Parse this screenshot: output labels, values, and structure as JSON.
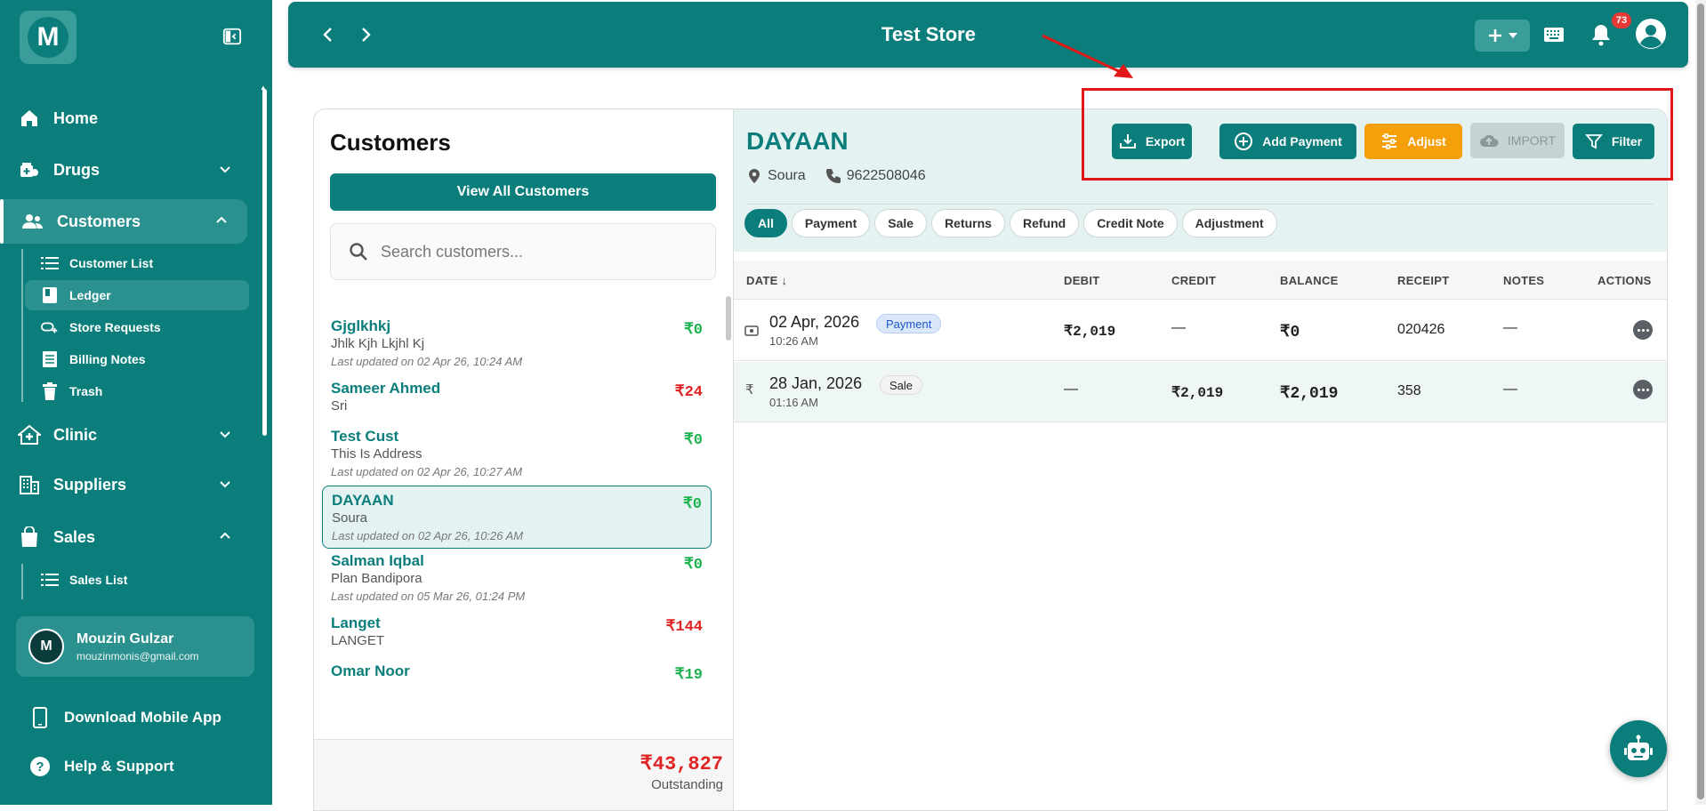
{
  "sidebar": {
    "logo_letter": "M",
    "nav": {
      "home": "Home",
      "drugs": "Drugs",
      "customers": "Customers",
      "clinic": "Clinic",
      "suppliers": "Suppliers",
      "sales": "Sales"
    },
    "customers_sub": [
      "Customer List",
      "Ledger",
      "Store Requests",
      "Billing Notes",
      "Trash"
    ],
    "sales_sub": [
      "Sales List"
    ],
    "user": {
      "initial": "M",
      "name": "Mouzin Gulzar",
      "email": "mouzinmonis@gmail.com"
    },
    "download_app": "Download Mobile App",
    "help": "Help & Support"
  },
  "topbar": {
    "title": "Test Store",
    "notification_count": "73"
  },
  "customers_panel": {
    "title": "Customers",
    "view_all": "View All Customers",
    "search_placeholder": "Search customers...",
    "items": [
      {
        "name": "Gjglkhkj",
        "sub": "Jhlk Kjh Lkjhl Kj",
        "updated": "Last updated on 02 Apr 26, 10:24 AM",
        "amount": "₹0",
        "status": "zero"
      },
      {
        "name": "Sameer Ahmed",
        "sub": "Sri",
        "updated": "",
        "amount": "₹24",
        "status": "due"
      },
      {
        "name": "Test Cust",
        "sub": "This Is Address",
        "updated": "Last updated on 02 Apr 26, 10:27 AM",
        "amount": "₹0",
        "status": "zero"
      },
      {
        "name": "DAYAAN",
        "sub": "Soura",
        "updated": "Last updated on 02 Apr 26, 10:26 AM",
        "amount": "₹0",
        "status": "zero"
      },
      {
        "name": "Salman Iqbal",
        "sub": "Plan Bandipora",
        "updated": "Last updated on 05 Mar 26, 01:24 PM",
        "amount": "₹0",
        "status": "zero"
      },
      {
        "name": "Langet",
        "sub": "LANGET",
        "updated": "",
        "amount": "₹144",
        "status": "due"
      },
      {
        "name": "Omar Noor",
        "sub": "",
        "updated": "",
        "amount": "₹19",
        "status": "zero"
      }
    ],
    "outstanding_amount": "₹43,827",
    "outstanding_label": "Outstanding"
  },
  "ledger": {
    "customer_name": "DAYAAN",
    "location": "Soura",
    "phone": "9622508046",
    "buttons": {
      "export": "Export",
      "add_payment": "Add Payment",
      "adjust": "Adjust",
      "import": "IMPORT",
      "filter": "Filter"
    },
    "filters": [
      "All",
      "Payment",
      "Sale",
      "Returns",
      "Refund",
      "Credit Note",
      "Adjustment"
    ],
    "active_filter": "All",
    "columns": {
      "date": "DATE ↓",
      "debit": "DEBIT",
      "credit": "CREDIT",
      "balance": "BALANCE",
      "receipt": "RECEIPT",
      "notes": "NOTES",
      "actions": "ACTIONS"
    },
    "rows": [
      {
        "date": "02 Apr, 2026",
        "time": "10:26 AM",
        "type": "Payment",
        "debit": "₹2,019",
        "credit": "—",
        "balance": "₹0",
        "receipt": "020426",
        "notes": "—"
      },
      {
        "date": "28 Jan, 2026",
        "time": "01:16 AM",
        "type": "Sale",
        "debit": "—",
        "credit": "₹2,019",
        "balance": "₹2,019",
        "receipt": "358",
        "notes": "—"
      }
    ]
  },
  "colors": {
    "brand": "#0b7e7b",
    "accent_orange": "#f5a00a",
    "positive": "#1cb34f",
    "negative": "#e02424",
    "annotation": "#e01818"
  }
}
